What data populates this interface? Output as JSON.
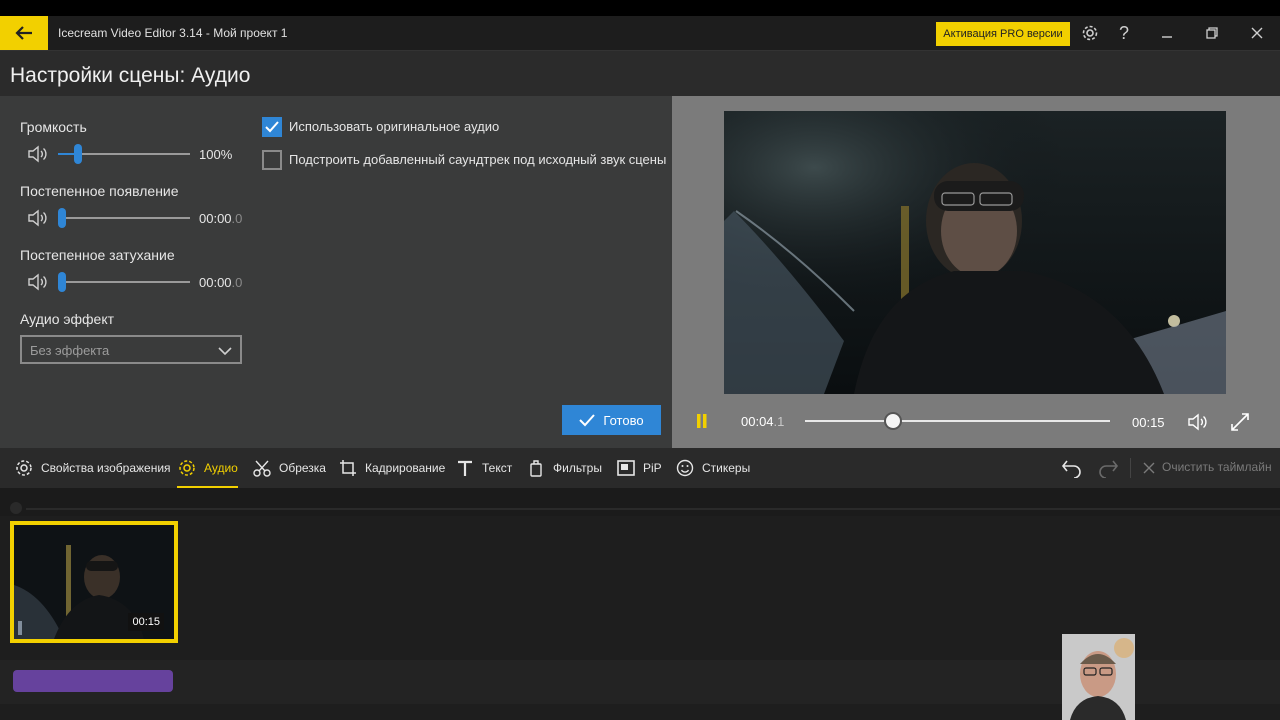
{
  "titlebar": {
    "app_title": "Icecream Video Editor 3.14  -  Мой проект 1",
    "pro_button": "Активация PRO версии",
    "help_glyph": "?"
  },
  "page_title": "Настройки сцены: Аудио",
  "audio_settings": {
    "volume": {
      "label": "Громкость",
      "value": "100%",
      "level": 0.15
    },
    "fade_in": {
      "label": "Постепенное появление",
      "value_main": "00:00",
      "value_frac": ".0",
      "level": 0.0
    },
    "fade_out": {
      "label": "Постепенное затухание",
      "value_main": "00:00",
      "value_frac": ".0",
      "level": 0.0
    },
    "effect": {
      "label": "Аудио эффект",
      "selected": "Без эффекта"
    },
    "use_original_audio": {
      "label": "Использовать оригинальное аудио",
      "checked": true
    },
    "adjust_soundtrack": {
      "label": "Подстроить добавленный саундтрек под исходный звук сцены",
      "checked": false
    },
    "done_button": "Готово"
  },
  "player": {
    "current_main": "00:04",
    "current_frac": ".1",
    "duration": "00:15",
    "progress": 0.29
  },
  "toolbar": {
    "tools": [
      {
        "label": "Свойства изображения",
        "icon": "gear-icon",
        "active": false
      },
      {
        "label": "Аудио",
        "icon": "gear-icon",
        "active": true
      },
      {
        "label": "Обрезка",
        "icon": "scissors-icon",
        "active": false
      },
      {
        "label": "Кадрирование",
        "icon": "crop-icon",
        "active": false
      },
      {
        "label": "Текст",
        "icon": "text-icon",
        "active": false
      },
      {
        "label": "Фильтры",
        "icon": "filter-icon",
        "active": false
      },
      {
        "label": "PiP",
        "icon": "pip-icon",
        "active": false
      },
      {
        "label": "Стикеры",
        "icon": "smiley-icon",
        "active": false
      }
    ],
    "clear_timeline": "Очистить таймлайн"
  },
  "timeline": {
    "clip_duration": "00:15"
  },
  "colors": {
    "accent_yellow": "#f2d000",
    "accent_blue": "#2f86d6",
    "audio_clip": "#7d4ec7"
  }
}
